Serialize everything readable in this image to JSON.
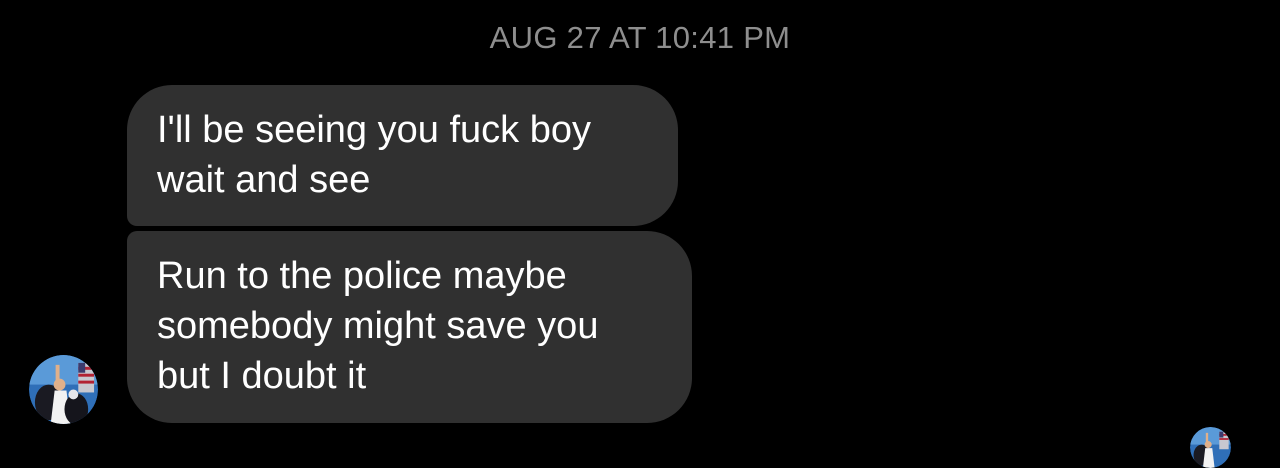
{
  "conversation": {
    "timestamp": "AUG 27 AT 10:41 PM",
    "messages": [
      {
        "lines": [
          "I'll be seeing you fuck boy",
          "wait and see"
        ]
      },
      {
        "lines": [
          "Run to the police maybe",
          "somebody might save you",
          "but I doubt it"
        ]
      }
    ]
  },
  "avatars": {
    "sender": "profile-photo-icon",
    "read_receipt": "profile-photo-icon"
  },
  "colors": {
    "background": "#000000",
    "bubble": "#303030",
    "timestamp": "#8e8e8e",
    "text": "#ffffff"
  }
}
